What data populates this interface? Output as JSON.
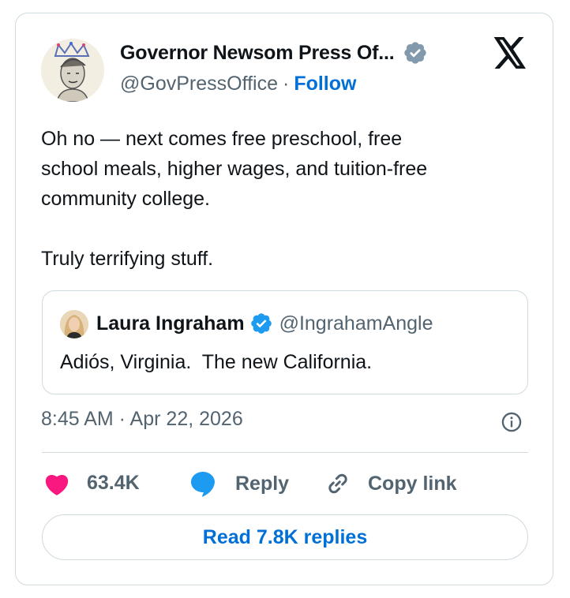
{
  "author": {
    "display_name": "Governor Newsom Press Of...",
    "handle": "@GovPressOffice",
    "separator": "·",
    "follow_label": "Follow"
  },
  "tweet": {
    "text": "Oh no — next comes free preschool, free\nschool meals, higher wages, and tuition-free\ncommunity college.\n\nTruly terrifying stuff."
  },
  "quoted": {
    "display_name": "Laura Ingraham",
    "handle": "@IngrahamAngle",
    "text": "Adiós, Virginia.  The new California."
  },
  "meta": {
    "timestamp": "8:45 AM · Apr 22, 2026"
  },
  "actions": {
    "like_count": "63.4K",
    "reply_label": "Reply",
    "copy_label": "Copy link"
  },
  "read_replies_label": "Read 7.8K replies",
  "colors": {
    "link_blue": "#006fd6",
    "verified_gray": "#829aab",
    "verified_blue": "#1d9bf0",
    "like_pink": "#f91880",
    "reply_blue": "#1d9bf0",
    "muted_text": "#536471",
    "border": "#cfd9de"
  },
  "icons": [
    "x-logo-icon",
    "verified-badge-icon",
    "info-icon",
    "heart-icon",
    "reply-bubble-icon",
    "link-icon"
  ]
}
